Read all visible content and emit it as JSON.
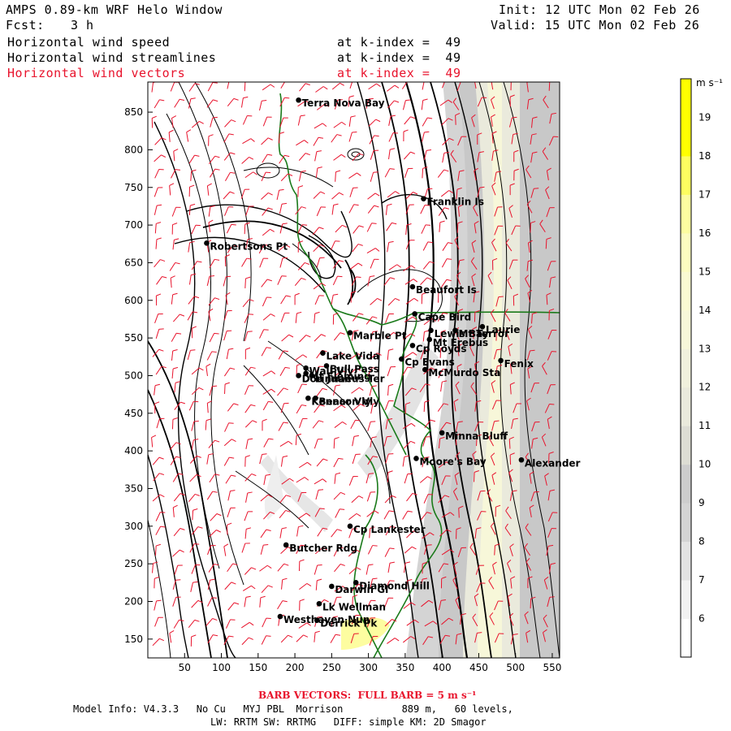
{
  "header": {
    "title": "AMPS 0.89-km WRF Helo Window",
    "forecast_label": "Fcst:",
    "forecast_value": "3 h",
    "init": "Init: 12 UTC Mon 02 Feb 26",
    "valid": "Valid: 15 UTC Mon 02 Feb 26",
    "fields": [
      {
        "name": "Horizontal wind speed",
        "level": "at k-index =  49",
        "color": "#000000"
      },
      {
        "name": "Horizontal wind streamlines",
        "level": "at k-index =  49",
        "color": "#000000"
      },
      {
        "name": "Horizontal wind vectors",
        "level": "at k-index =  49",
        "color": "#e8132c"
      }
    ]
  },
  "map": {
    "x_ticks": [
      "50",
      "100",
      "150",
      "200",
      "250",
      "300",
      "350",
      "400",
      "450",
      "500",
      "550"
    ],
    "y_ticks": [
      "850",
      "800",
      "750",
      "700",
      "650",
      "600",
      "550",
      "500",
      "450",
      "400",
      "350",
      "300",
      "250",
      "200",
      "150"
    ],
    "x_range": [
      0,
      560
    ],
    "y_range": [
      125,
      890
    ],
    "coastline_color": "#1a7a1a",
    "barb_color": "#e8132c",
    "places": [
      {
        "name": "Terra Nova Bay",
        "x": 205,
        "y": 866
      },
      {
        "name": "Franklin Is",
        "x": 375,
        "y": 735
      },
      {
        "name": "Robertsons Pt",
        "x": 80,
        "y": 676
      },
      {
        "name": "Beaufort Is",
        "x": 360,
        "y": 618
      },
      {
        "name": "Cape Bird",
        "x": 363,
        "y": 582
      },
      {
        "name": "Lewis Bay",
        "x": 385,
        "y": 560
      },
      {
        "name": "Mt Terror",
        "x": 418,
        "y": 560
      },
      {
        "name": "Laurie",
        "x": 455,
        "y": 565
      },
      {
        "name": "Marble Pt",
        "x": 275,
        "y": 557
      },
      {
        "name": "Mt Erebus",
        "x": 383,
        "y": 548
      },
      {
        "name": "Cp Royds",
        "x": 360,
        "y": 540
      },
      {
        "name": "Lake Vida",
        "x": 238,
        "y": 530
      },
      {
        "name": "Cp Evans",
        "x": 345,
        "y": 522
      },
      {
        "name": "Fenix",
        "x": 480,
        "y": 520
      },
      {
        "name": "Wall Vly",
        "x": 215,
        "y": 510
      },
      {
        "name": "Bull Pass",
        "x": 243,
        "y": 513
      },
      {
        "name": "McMurdo Sta",
        "x": 377,
        "y": 508
      },
      {
        "name": "Don Juan",
        "x": 205,
        "y": 500
      },
      {
        "name": "Linnaeus Ter",
        "x": 223,
        "y": 500
      },
      {
        "name": "Mt Fleming",
        "x": 215,
        "y": 503
      },
      {
        "name": "Kennar Vly",
        "x": 218,
        "y": 470
      },
      {
        "name": "Beacon Vly",
        "x": 228,
        "y": 470
      },
      {
        "name": "Minna Bluff",
        "x": 400,
        "y": 424
      },
      {
        "name": "Moore's Bay",
        "x": 365,
        "y": 390
      },
      {
        "name": "Alexander",
        "x": 508,
        "y": 388
      },
      {
        "name": "Cp Lankester",
        "x": 275,
        "y": 300
      },
      {
        "name": "Butcher Rdg",
        "x": 188,
        "y": 275
      },
      {
        "name": "Diamond Hill",
        "x": 283,
        "y": 225
      },
      {
        "name": "Darwin Gl",
        "x": 250,
        "y": 220
      },
      {
        "name": "Lk Wellman",
        "x": 233,
        "y": 197
      },
      {
        "name": "Westhaven Nun",
        "x": 180,
        "y": 180
      },
      {
        "name": "Derrick Pk",
        "x": 230,
        "y": 175
      }
    ]
  },
  "colorbar": {
    "unit": "m s⁻¹",
    "levels": [
      "6",
      "7",
      "8",
      "9",
      "10",
      "11",
      "12",
      "13",
      "14",
      "15",
      "16",
      "17",
      "18",
      "19"
    ],
    "colors": [
      "#ffffff",
      "#f2f2f2",
      "#e3e3e3",
      "#d4d4d4",
      "#cdcdcd",
      "#ddddd4",
      "#eaeadc",
      "#f1f1dd",
      "#f7f7d9",
      "#fafad2",
      "#fcfcc0",
      "#fdfda0",
      "#fefe60",
      "#ffff00",
      "#ffff00"
    ]
  },
  "footer": {
    "barb_note": "BARB VECTORS:  FULL BARB = 5 m s⁻¹",
    "model_info": "Model Info: V4.3.3   No Cu   MYJ PBL  Morrison          889 m,   60 levels,",
    "physics": "LW: RRTM SW: RRTMG   DIFF: simple KM: 2D Smagor"
  }
}
